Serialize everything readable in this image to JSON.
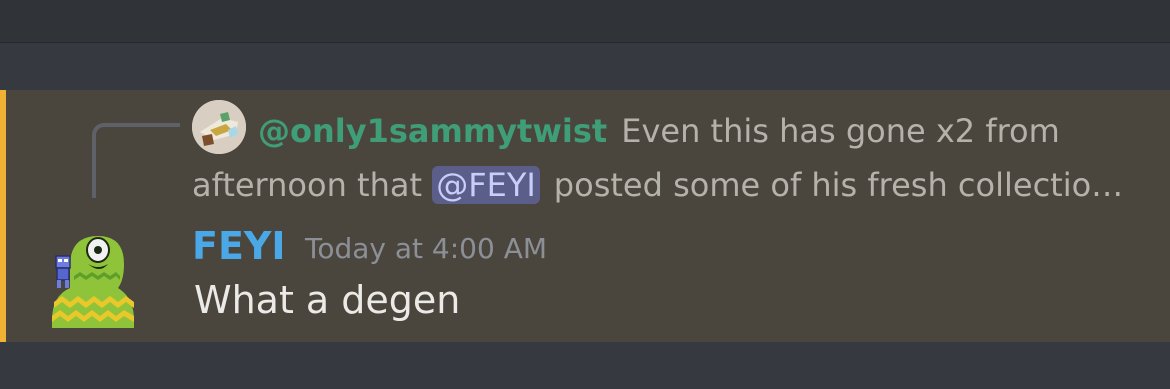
{
  "message": {
    "reply": {
      "author": "@only1sammytwist",
      "text_line1": "Even this has gone x2 from",
      "text_before_mention": "afternoon that",
      "mention": "@FEYI",
      "text_after_mention": "posted some of his fresh collectio…"
    },
    "author": "FEYI",
    "timestamp": "Today at 4:00 AM",
    "content": "What a degen"
  },
  "colors": {
    "mention_highlight": "#f0b232",
    "reply_author": "#3f9e78",
    "author": "#4aa8e6"
  }
}
